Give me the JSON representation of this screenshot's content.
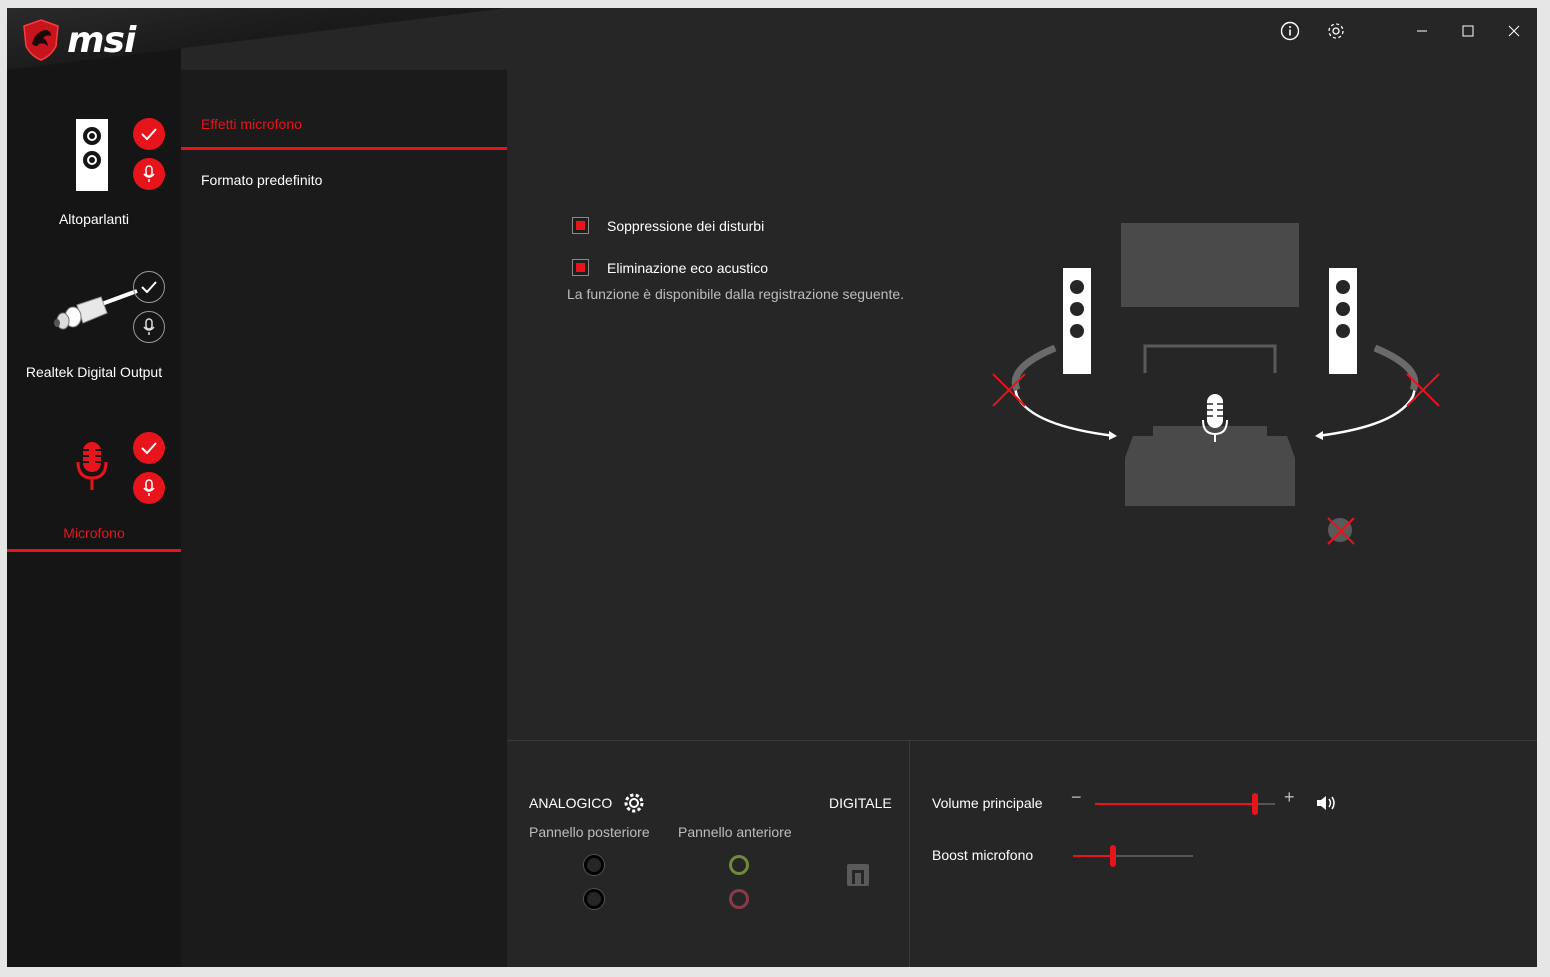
{
  "brand": {
    "logo_text": "msi",
    "accent": "#e8141c"
  },
  "devices": [
    {
      "label": "Altoparlanti",
      "default_device": true,
      "default_comm": true
    },
    {
      "label": "Realtek Digital Output",
      "default_device": false,
      "default_comm": false
    },
    {
      "label": "Microfono",
      "default_device": true,
      "default_comm": true,
      "active": true
    }
  ],
  "tabs": [
    {
      "label": "Effetti microfono",
      "active": true
    },
    {
      "label": "Formato predefinito",
      "active": false
    }
  ],
  "window_controls": [
    "info-icon",
    "settings-icon",
    "minimize-icon",
    "maximize-icon",
    "close-icon"
  ],
  "effects": {
    "noise_suppression": {
      "label": "Soppressione dei disturbi",
      "checked": true
    },
    "echo_cancellation": {
      "label": "Eliminazione eco acustico",
      "checked": true
    },
    "note": "La funzione è disponibile dalla registrazione seguente."
  },
  "connectors": {
    "analog_label": "ANALOGICO",
    "digital_label": "DIGITALE",
    "rear_panel": "Pannello posteriore",
    "front_panel": "Pannello anteriore",
    "rear_jacks": [
      "#000000",
      "#000000"
    ],
    "front_jacks": [
      "#6e8a3a",
      "#8a3a4a"
    ]
  },
  "volume": {
    "main_label": "Volume principale",
    "main_level": 0.89,
    "minus": "−",
    "plus": "+",
    "boost_label": "Boost microfono",
    "boost_level": 0.33
  }
}
